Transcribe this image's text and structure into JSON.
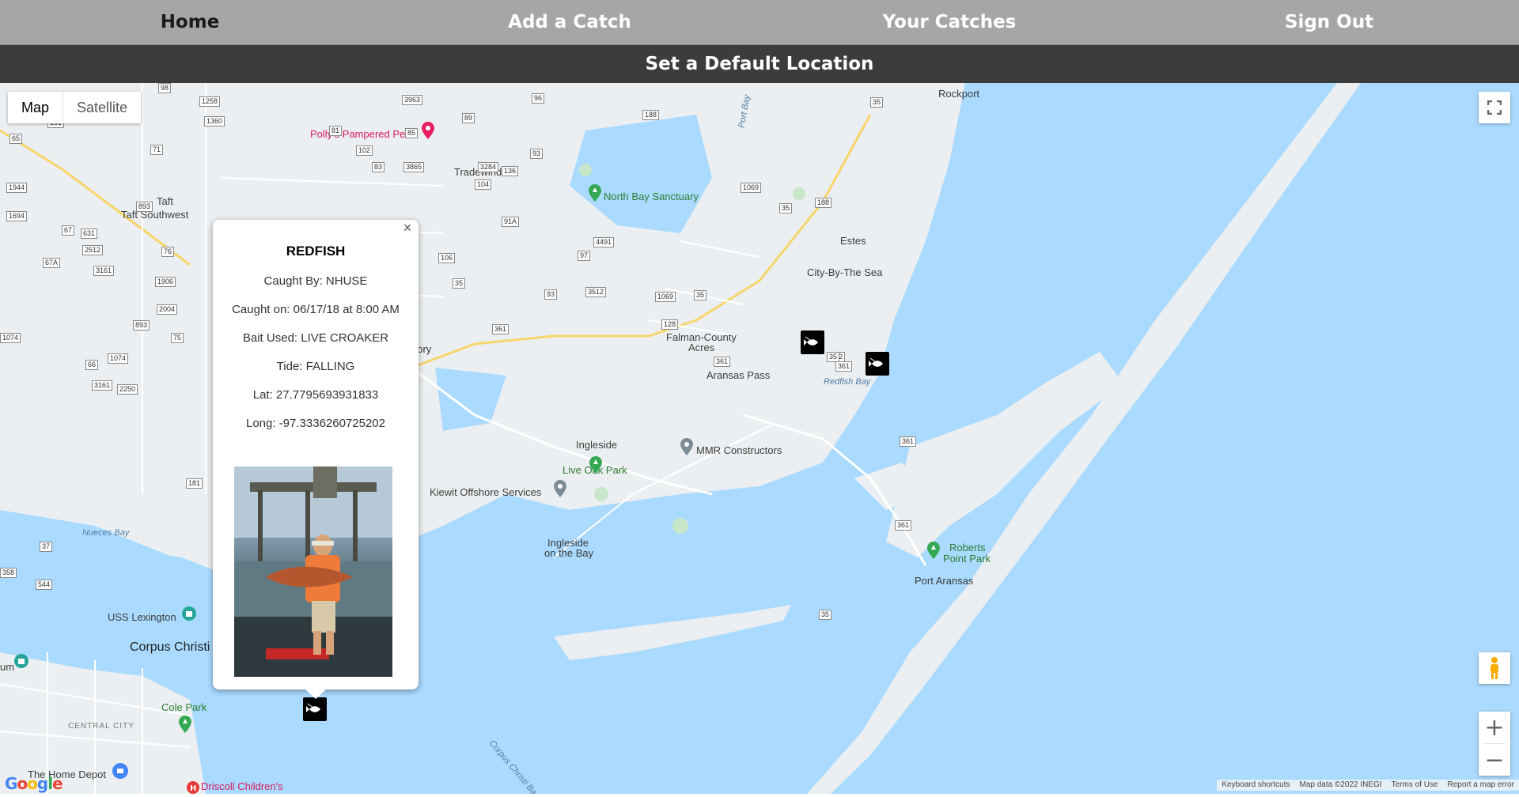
{
  "nav": {
    "home": "Home",
    "add_catch": "Add a Catch",
    "your_catches": "Your Catches",
    "sign_out": "Sign Out",
    "default_location": "Set a Default Location"
  },
  "map_controls": {
    "map_label": "Map",
    "satellite_label": "Satellite",
    "zoom_in": "+",
    "zoom_out": "−",
    "fullscreen_icon": "fullscreen-icon",
    "pegman_icon": "pegman-icon"
  },
  "attribution": {
    "keyboard": "Keyboard shortcuts",
    "map_data": "Map data ©2022 INEGI",
    "terms": "Terms of Use",
    "report": "Report a map error"
  },
  "google_logo": [
    "G",
    "o",
    "o",
    "g",
    "l",
    "e"
  ],
  "info_window": {
    "species": "REDFISH",
    "caught_by": "Caught By: NHUSE",
    "caught_on": "Caught on: 06/17/18 at 8:00 AM",
    "bait": "Bait Used: LIVE CROAKER",
    "tide": "Tide: FALLING",
    "lat": "Lat: 27.7795693931833",
    "long": "Long: -97.3336260725202",
    "close": "×"
  },
  "places": {
    "rockport": "Rockport",
    "pollys": "Polly's Pampered Pets",
    "tradewinds": "Tradewinds",
    "north_bay": "North Bay Sanctuary",
    "taft": "Taft",
    "taft_sw": "Taft Southwest",
    "estes": "Estes",
    "city_by_sea": "City-By-The Sea",
    "falman": "Falman-County",
    "acres": "Acres",
    "aransas_pass": "Aransas Pass",
    "redfish_bay": "Redfish Bay",
    "ingleside": "Ingleside",
    "mmr": "MMR Constructors",
    "live_oak": "Live Oak Park",
    "kiewit": "Kiewit Offshore Services",
    "ingleside_bay": "Ingleside",
    "ingleside_bay2": "on the Bay",
    "roberts": "Roberts",
    "roberts2": "Point Park",
    "port_aransas": "Port Aransas",
    "nueces_bay": "Nueces Bay",
    "uss": "USS Lexington",
    "corpus": "Corpus Christi",
    "cole_park": "Cole Park",
    "central_city": "CENTRAL CITY",
    "home_depot": "The Home Depot",
    "driscoll": "Driscoll Children's",
    "gory": "gory",
    "port_bay": "Port Bay",
    "corpus_channel": "Corpus Christi Ba",
    "um": "um"
  },
  "shields": [
    "98",
    "1258",
    "3963",
    "96",
    "188",
    "35",
    "181",
    "1360",
    "89",
    "65",
    "71",
    "81",
    "85",
    "93",
    "102",
    "83",
    "3865",
    "3284",
    "136",
    "104",
    "1944",
    "893",
    "1694",
    "67",
    "631",
    "2512",
    "76",
    "67A",
    "3161",
    "1906",
    "2004",
    "893",
    "75",
    "1074",
    "1074",
    "66",
    "3161",
    "2250",
    "1069",
    "188",
    "35",
    "91A",
    "4491",
    "97",
    "106",
    "35",
    "93",
    "3512",
    "1069",
    "128",
    "35",
    "361",
    "361",
    "361",
    "361",
    "361",
    "181",
    "37",
    "544",
    "358",
    "35",
    "102",
    "35"
  ]
}
